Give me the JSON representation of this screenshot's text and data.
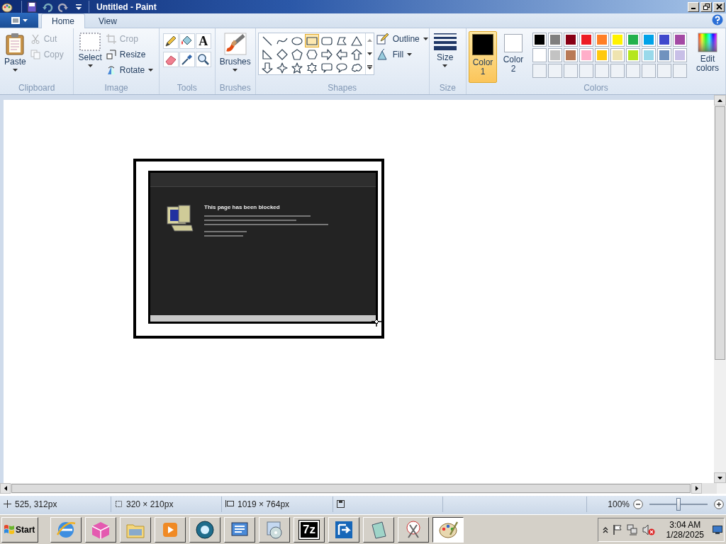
{
  "window": {
    "title": "Untitled - Paint",
    "quick_access": [
      {
        "kind": "save"
      },
      {
        "kind": "undo"
      },
      {
        "kind": "redo"
      },
      {
        "kind": "customize"
      }
    ]
  },
  "tabs": [
    {
      "label": "Home",
      "selected": true
    },
    {
      "label": "View",
      "selected": false
    }
  ],
  "ribbon": {
    "clipboard": {
      "label": "Clipboard",
      "paste": "Paste",
      "cut": {
        "label": "Cut",
        "disabled": true
      },
      "copy": {
        "label": "Copy",
        "disabled": true
      }
    },
    "image": {
      "label": "Image",
      "select": "Select",
      "crop": {
        "label": "Crop",
        "disabled": true
      },
      "resize": {
        "label": "Resize",
        "disabled": false
      },
      "rotate": {
        "label": "Rotate",
        "disabled": false
      }
    },
    "tools": {
      "label": "Tools",
      "items": [
        {
          "kind": "pencil",
          "selected": false
        },
        {
          "kind": "fill",
          "selected": false
        },
        {
          "kind": "text",
          "text": "A",
          "selected": false
        },
        {
          "kind": "eraser",
          "selected": false
        },
        {
          "kind": "picker",
          "selected": false
        },
        {
          "kind": "magnifier",
          "selected": false
        }
      ]
    },
    "brushes": {
      "label": "Brushes",
      "button": "Brushes"
    },
    "shapes": {
      "label": "Shapes",
      "outline": "Outline",
      "fill": "Fill",
      "items": [
        {
          "kind": "line",
          "selected": false
        },
        {
          "kind": "curve",
          "selected": false
        },
        {
          "kind": "oval",
          "selected": false
        },
        {
          "kind": "rectangle",
          "selected": true
        },
        {
          "kind": "rounded-rectangle",
          "selected": false
        },
        {
          "kind": "polygon",
          "selected": false
        },
        {
          "kind": "triangle",
          "selected": false
        },
        {
          "kind": "right-triangle",
          "selected": false
        },
        {
          "kind": "diamond",
          "selected": false
        },
        {
          "kind": "pentagon",
          "selected": false
        },
        {
          "kind": "hexagon",
          "selected": false
        },
        {
          "kind": "right-arrow",
          "selected": false
        },
        {
          "kind": "left-arrow",
          "selected": false
        },
        {
          "kind": "up-arrow",
          "selected": false
        },
        {
          "kind": "down-arrow",
          "selected": false
        },
        {
          "kind": "four-point-star",
          "selected": false
        },
        {
          "kind": "five-point-star",
          "selected": false
        },
        {
          "kind": "six-point-star",
          "selected": false
        },
        {
          "kind": "rounded-callout",
          "selected": false
        },
        {
          "kind": "oval-callout",
          "selected": false
        },
        {
          "kind": "cloud-callout",
          "selected": false
        }
      ]
    },
    "size": {
      "label": "Size",
      "button": "Size"
    },
    "colors": {
      "label": "Colors",
      "edit": "Edit colors",
      "active": [
        {
          "label": "Color 1",
          "color": "#000000",
          "selected": true
        },
        {
          "label": "Color 2",
          "color": "#ffffff",
          "selected": false
        }
      ],
      "palette": [
        {
          "kind": "swatch",
          "color": "#000000"
        },
        {
          "kind": "swatch",
          "color": "#7f7f7f"
        },
        {
          "kind": "swatch",
          "color": "#880015"
        },
        {
          "kind": "swatch",
          "color": "#ed1c24"
        },
        {
          "kind": "swatch",
          "color": "#ff7f27"
        },
        {
          "kind": "swatch",
          "color": "#fff200"
        },
        {
          "kind": "swatch",
          "color": "#22b14c"
        },
        {
          "kind": "swatch",
          "color": "#00a2e8"
        },
        {
          "kind": "swatch",
          "color": "#3f48cc"
        },
        {
          "kind": "swatch",
          "color": "#a349a4"
        },
        {
          "kind": "swatch",
          "color": "#ffffff"
        },
        {
          "kind": "swatch",
          "color": "#c3c3c3"
        },
        {
          "kind": "swatch",
          "color": "#b97a57"
        },
        {
          "kind": "swatch",
          "color": "#ffaec9"
        },
        {
          "kind": "swatch",
          "color": "#ffc90e"
        },
        {
          "kind": "swatch",
          "color": "#efe4b0"
        },
        {
          "kind": "swatch",
          "color": "#b5e61d"
        },
        {
          "kind": "swatch",
          "color": "#99d9ea"
        },
        {
          "kind": "swatch",
          "color": "#7092be"
        },
        {
          "kind": "swatch",
          "color": "#c8bfe7"
        },
        {
          "kind": "empty"
        },
        {
          "kind": "empty"
        },
        {
          "kind": "empty"
        },
        {
          "kind": "empty"
        },
        {
          "kind": "empty"
        },
        {
          "kind": "empty"
        },
        {
          "kind": "empty"
        },
        {
          "kind": "empty"
        },
        {
          "kind": "empty"
        },
        {
          "kind": "empty"
        }
      ]
    }
  },
  "canvas": {
    "pasted_image": {
      "heading": "This page has been blocked"
    }
  },
  "status_bar": {
    "cursor": "525, 312px",
    "selection": "320 × 210px",
    "image_size": "1019 × 764px",
    "zoom": "100%",
    "zoom_slider": {
      "level": 0.5
    }
  },
  "taskbar": {
    "start": "Start",
    "apps": [
      {
        "kind": "browser",
        "selected": false
      },
      {
        "kind": "cube",
        "selected": false
      },
      {
        "kind": "folder",
        "selected": false
      },
      {
        "kind": "player",
        "selected": false
      },
      {
        "kind": "orb",
        "selected": false
      },
      {
        "kind": "panel",
        "selected": false
      },
      {
        "kind": "disc",
        "selected": false
      },
      {
        "kind": "archive",
        "text": "7z",
        "selected": false
      },
      {
        "kind": "arrow",
        "selected": false
      },
      {
        "kind": "notepad",
        "selected": false
      },
      {
        "kind": "scissors",
        "selected": false
      },
      {
        "kind": "palette",
        "selected": true
      }
    ],
    "clock": {
      "time": "3:04 AM",
      "date": "1/28/2025"
    }
  }
}
